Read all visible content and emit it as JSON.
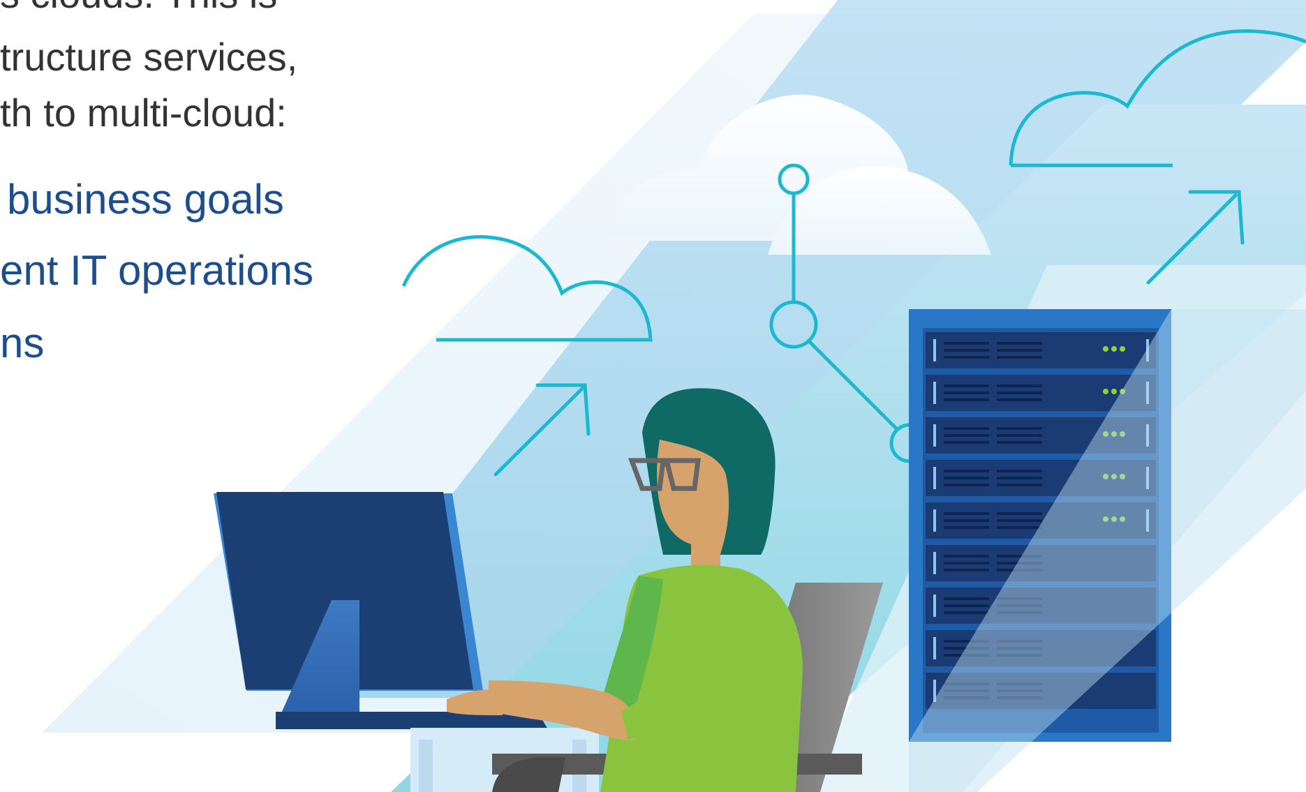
{
  "text": {
    "intro_lines": [
      "s clouds. This is",
      "tructure services,",
      "th to multi-cloud:"
    ],
    "bullets": [
      "business goals",
      "ent IT operations",
      "ns"
    ]
  },
  "icons": [
    "cloud-icon",
    "cloud-outline-icon",
    "arrow-up-right-icon",
    "network-node-icon",
    "server-rack-icon",
    "monitor-icon",
    "person-icon",
    "office-chair-icon"
  ],
  "colors": {
    "bullet_text": "#1b4d8f",
    "intro_text": "#333333",
    "accent_teal": "#1bb8d1",
    "server_blue": "#1f5aa6",
    "server_dark": "#1a3b73",
    "monitor_blue": "#1b3e73",
    "sky_light": "#d2ebf7",
    "sky_mid": "#a9d7f0",
    "shirt_green": "#8ac43f",
    "hair_teal": "#0f6964",
    "skin": "#d7a36d",
    "led_green": "#8ad13a"
  }
}
